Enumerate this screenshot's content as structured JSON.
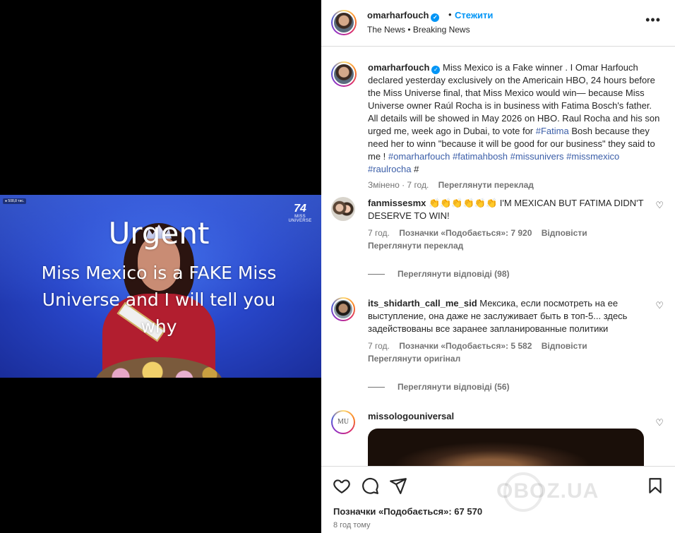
{
  "video": {
    "live_badge": "● 508,8 тис.",
    "logo_number": "74",
    "logo_text": "MISS UNIVERSE",
    "title": "Urgent",
    "subtitle": "Miss Mexico is a FAKE Miss Universe and I will tell you why"
  },
  "header": {
    "username": "omarharfouch",
    "verified": "✓",
    "separator": "•",
    "follow_label": "Стежити",
    "subtitle": "The News • Breaking News",
    "more_icon": "•••"
  },
  "caption": {
    "username": "omarharfouch",
    "text_1": "Miss Mexico is a Fake winner . I Omar Harfouch declared yesterday exclusively on the Americain HBO, 24 hours before the Miss Universe final, that Miss Mexico would win— because Miss Universe owner Raúl Rocha is in business with Fatima Bosch's father. All details will be showed in May 2026 on HBO. Raul Rocha and his son urged me, week ago in Dubai, to vote for ",
    "hashtag_fatima": "#Fatima",
    "text_2": " Bosh because they need her to winn \"because it will be good for our business\" they said to me ! ",
    "hashtag_omar": "#omarharfouch",
    "hashtag_fatimahbosh": "#fatimahbosh",
    "hashtag_missunivers": "#missunivers",
    "hashtag_missmexico": "#missmexico",
    "hashtag_raulrocha": "#raulrocha",
    "hashtag_end": "#",
    "edited": "Змінено · 7 год.",
    "see_translation": "Переглянути переклад"
  },
  "comments": [
    {
      "username": "fanmissesmx",
      "text": "👏👏👏👏👏👏 I'M MEXICAN BUT FATIMA DIDN'T DESERVE TO WIN!",
      "time": "7 год.",
      "likes": "Позначки «Подобається»: 7 920",
      "reply": "Відповісти",
      "translate": "Переглянути переклад",
      "view_replies": "Переглянути відповіді (98)"
    },
    {
      "username": "its_shidarth_call_me_sid",
      "text": "Мексика, если посмотреть на ее выступление, она даже не заслуживает быть в топ-5... здесь задействованы все заранее запланированные политики",
      "time": "7 год.",
      "likes": "Позначки «Подобається»: 5 582",
      "reply": "Відповісти",
      "translate": "Переглянути оригінал",
      "view_replies": "Переглянути відповіді (56)"
    },
    {
      "username": "missologouniversal",
      "avatar_text": "MU"
    }
  ],
  "heart_small": "♡",
  "footer": {
    "likes": "Позначки «Подобається»: 67 570",
    "time": "8 год тому",
    "watermark": "OBOZ.UA"
  }
}
